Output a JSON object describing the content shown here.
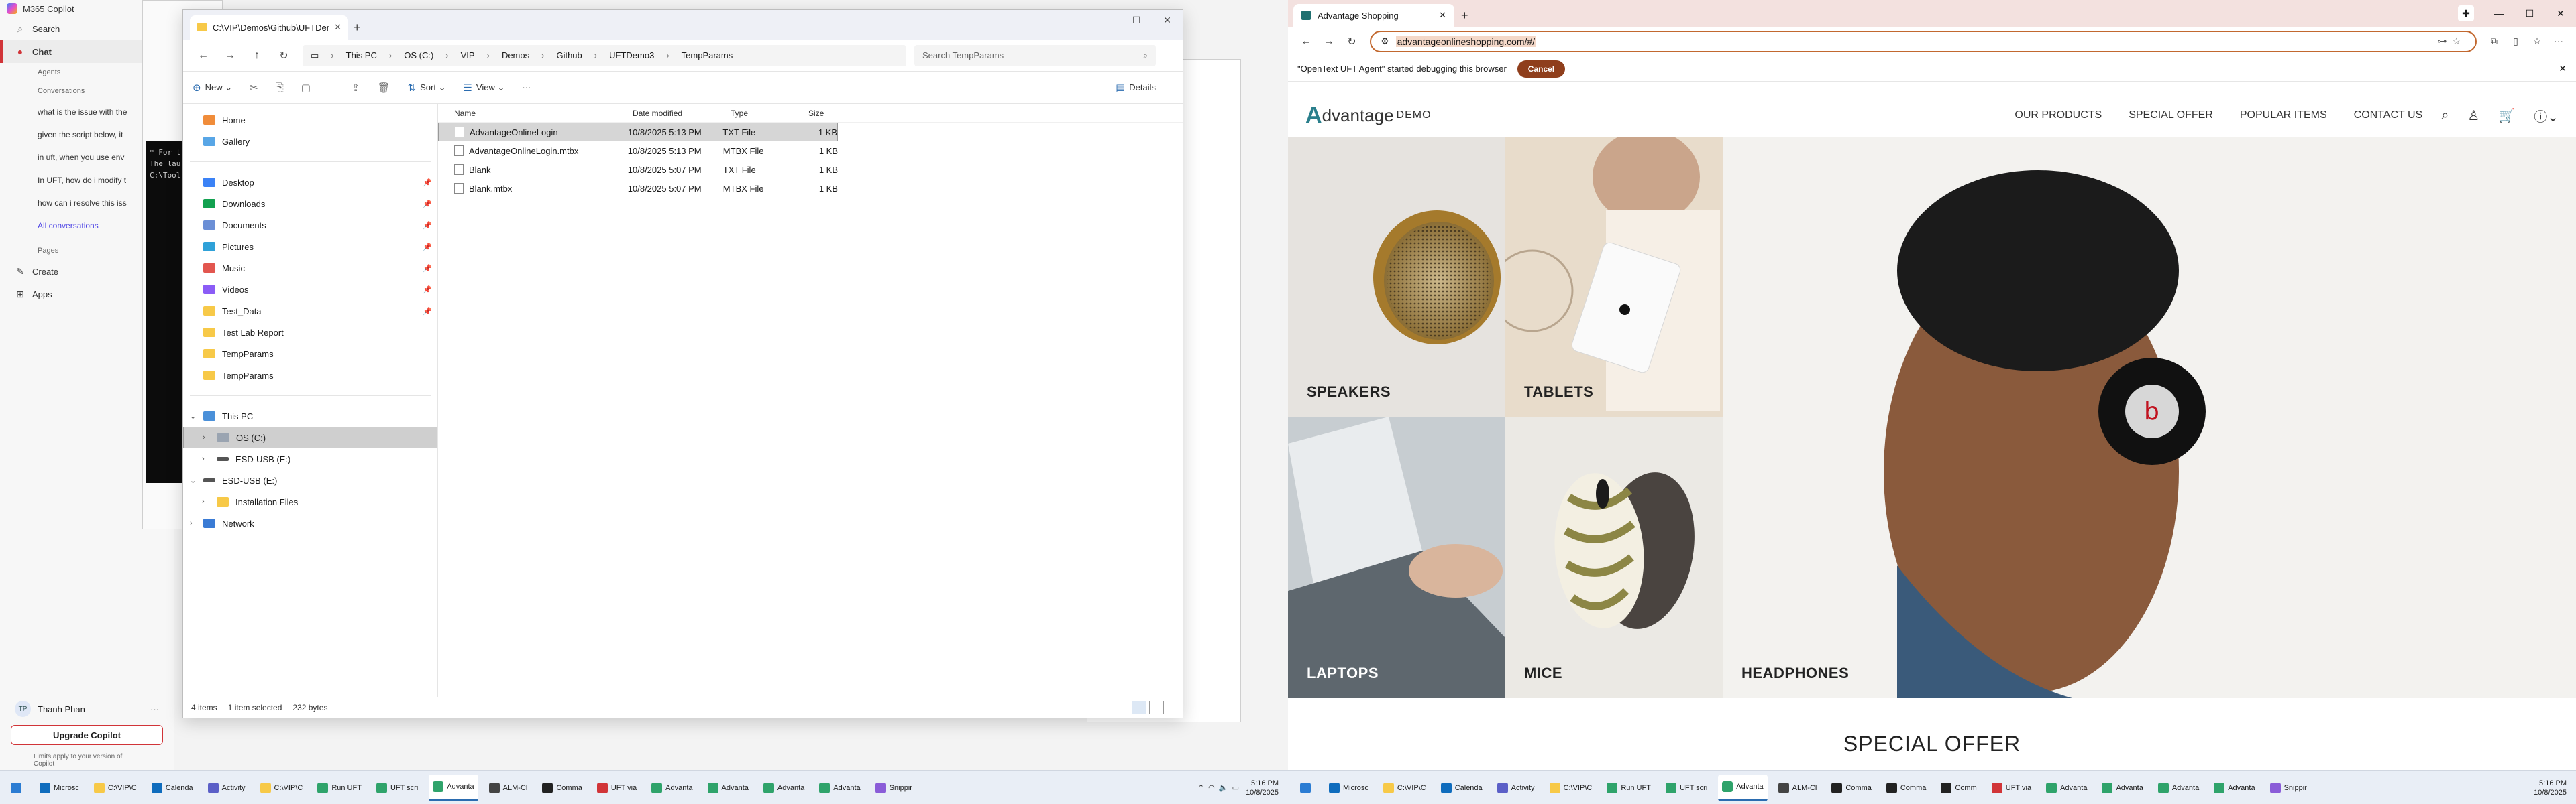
{
  "copilot": {
    "app_title": "M365 Copilot",
    "search": "Search",
    "chat": "Chat",
    "agents": "Agents",
    "conversations_header": "Conversations",
    "conversations": [
      "what is the issue with the",
      "given the script below, it",
      "in uft, when you use env",
      "In UFT, how do i modify t",
      "how can i resolve this iss"
    ],
    "all_conversations": "All conversations",
    "pages_header": "Pages",
    "create": "Create",
    "apps": "Apps",
    "user_initials": "TP",
    "user_name": "Thanh Phan",
    "upgrade": "Upgrade Copilot",
    "note": "Limits apply to your version of Copilot"
  },
  "cmd": {
    "lines": [
      "* For t",
      "The lau",
      "C:\\Tool"
    ]
  },
  "explorer": {
    "tab_title": "C:\\VIP\\Demos\\Github\\UFTDer",
    "breadcrumbs": [
      "This PC",
      "OS (C:)",
      "VIP",
      "Demos",
      "Github",
      "UFTDemo3",
      "TempParams"
    ],
    "search_placeholder": "Search TempParams",
    "toolbar": {
      "new": "New",
      "sort": "Sort",
      "view": "View",
      "more": "···",
      "details": "Details"
    },
    "nav": {
      "home": "Home",
      "gallery": "Gallery",
      "quick": [
        {
          "label": "Desktop",
          "icon": "desktop-icon"
        },
        {
          "label": "Downloads",
          "icon": "downloads-icon"
        },
        {
          "label": "Documents",
          "icon": "documents-icon"
        },
        {
          "label": "Pictures",
          "icon": "pictures-icon"
        },
        {
          "label": "Music",
          "icon": "music-icon"
        },
        {
          "label": "Videos",
          "icon": "videos-icon"
        },
        {
          "label": "Test_Data",
          "icon": "folder-icon"
        },
        {
          "label": "Test Lab Report",
          "icon": "folder-icon"
        },
        {
          "label": "TempParams",
          "icon": "folder-icon"
        },
        {
          "label": "TempParams",
          "icon": "folder-icon"
        }
      ],
      "this_pc": "This PC",
      "os_drive": "OS (C:)",
      "esd_usb_1": "ESD-USB (E:)",
      "esd_usb_2": "ESD-USB (E:)",
      "installation_files": "Installation Files",
      "network": "Network"
    },
    "columns": {
      "name": "Name",
      "date": "Date modified",
      "type": "Type",
      "size": "Size"
    },
    "files": [
      {
        "name": "AdvantageOnlineLogin",
        "date": "10/8/2025 5:13 PM",
        "type": "TXT File",
        "size": "1 KB"
      },
      {
        "name": "AdvantageOnlineLogin.mtbx",
        "date": "10/8/2025 5:13 PM",
        "type": "MTBX File",
        "size": "1 KB"
      },
      {
        "name": "Blank",
        "date": "10/8/2025 5:07 PM",
        "type": "TXT File",
        "size": "1 KB"
      },
      {
        "name": "Blank.mtbx",
        "date": "10/8/2025 5:07 PM",
        "type": "MTBX File",
        "size": "1 KB"
      }
    ],
    "status": {
      "count": "4 items",
      "selected": "1 item selected",
      "size": "232 bytes"
    }
  },
  "taskbar_left": {
    "items": [
      "Microsc",
      "C:\\VIP\\C",
      "Calenda",
      "Activity",
      "C:\\VIP\\C",
      "Run UFT",
      "UFT scri",
      "Advanta",
      "ALM-Cl",
      "Comma",
      "UFT via",
      "Advanta",
      "Advanta",
      "Advanta",
      "Advanta",
      "Snippir"
    ],
    "active_index": 7,
    "time": "5:16 PM",
    "date": "10/8/2025"
  },
  "browser": {
    "tab_title": "Advantage Shopping",
    "url": "advantageonlineshopping.com/#/",
    "info_text": "\"OpenText UFT Agent\" started debugging this browser",
    "cancel": "Cancel"
  },
  "site": {
    "logo_letter": "A",
    "logo_text": "dvantage",
    "logo_suffix": "DEMO",
    "menu": [
      "OUR PRODUCTS",
      "SPECIAL OFFER",
      "POPULAR ITEMS",
      "CONTACT US"
    ],
    "categories": [
      "SPEAKERS",
      "TABLETS",
      "HEADPHONES",
      "LAPTOPS",
      "MICE"
    ],
    "special_offer": "SPECIAL OFFER"
  },
  "taskbar_right": {
    "items": [
      "Microsc",
      "C:\\VIP\\C",
      "Calenda",
      "Activity",
      "C:\\VIP\\C",
      "Run UFT",
      "UFT scri",
      "Advanta",
      "ALM-Cl",
      "Comma",
      "Comma",
      "Comm",
      "UFT via",
      "Advanta",
      "Advanta",
      "Advanta",
      "Advanta",
      "Snippir"
    ],
    "active_index": 7,
    "time": "5:16 PM",
    "date": "10/8/2025"
  }
}
